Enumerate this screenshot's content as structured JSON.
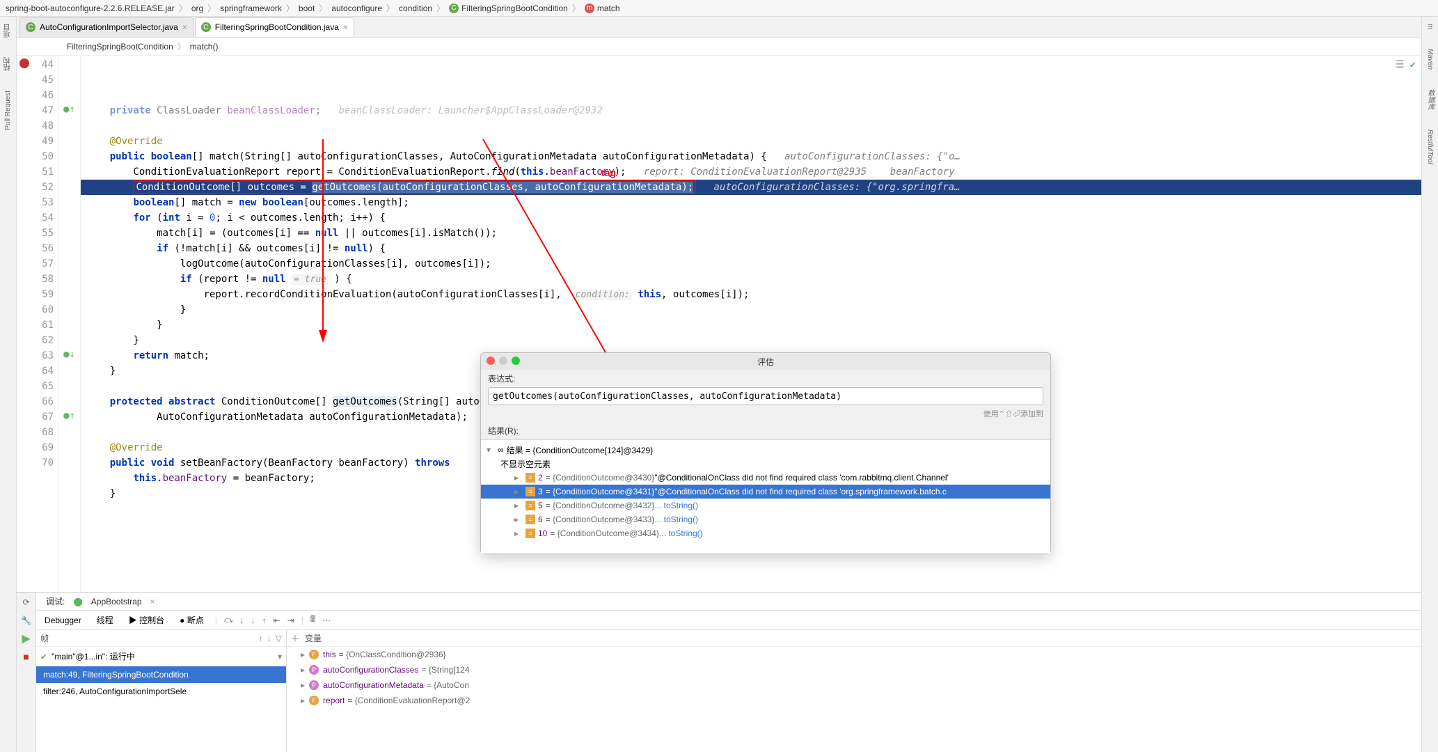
{
  "breadcrumb": {
    "items": [
      "spring-boot-autoconfigure-2.2.6.RELEASE.jar",
      "org",
      "springframework",
      "boot",
      "autoconfigure",
      "condition",
      "FilteringSpringBootCondition",
      "match"
    ],
    "class_icon": "C",
    "method_icon": "m"
  },
  "tabs": [
    {
      "icon": "C",
      "label": "AutoConfigurationImportSelector.java",
      "close": "×"
    },
    {
      "icon": "C",
      "label": "FilteringSpringBootCondition.java",
      "close": "×",
      "active": true
    }
  ],
  "inner_breadcrumb": {
    "class": "FilteringSpringBootCondition",
    "sep": "〉",
    "method": "match()"
  },
  "side_left": {
    "project": "项目",
    "structure": "结构",
    "pull": "Pull Request"
  },
  "side_right": {
    "maven": "Maven",
    "db": "数据库",
    "rest": "RestfulTool",
    "m": "m"
  },
  "editor_icons": {
    "reader": "☰",
    "check": "✔"
  },
  "annotation_tag": "tag",
  "code": {
    "lines": [
      {
        "n": 44,
        "html": "    <span class='kw'>private</span> ClassLoader <span class='field'>beanClassLoader</span>;   <span class='comment'>beanClassLoader: Launcher$AppClassLoader@2932</span>",
        "dim": true
      },
      {
        "n": 45,
        "html": ""
      },
      {
        "n": 46,
        "html": "    <span class='anno'>@Override</span>"
      },
      {
        "n": 47,
        "mark": "green-up",
        "html": "    <span class='kw'>public</span> <span class='kw'>boolean</span>[] match(String[] autoConfigurationClasses, AutoConfigurationMetadata autoConfigurationMetadata) {   <span class='comment'>autoConfigurationClasses: {\"o…</span>"
      },
      {
        "n": 48,
        "html": "        ConditionEvaluationReport report = ConditionEvaluationReport.<span style='font-style:italic'>find</span>(<span class='kw'>this</span>.<span class='field'>beanFactory</span>);   <span class='comment'>report: ConditionEvaluationReport@2935    beanFactory</span>"
      },
      {
        "n": 49,
        "mark": "red",
        "hl": true,
        "html": "        <span class='red-box'>ConditionOutcome[] outcomes = <span class='selbg'>getOutcomes(autoConfigurationClasses, autoConfigurationMetadata);</span></span>   <span class='comment' style='color:#cfd8e6'>autoConfigurationClasses: {\"org.springfra…</span>"
      },
      {
        "n": 50,
        "html": "        <span class='kw'>boolean</span>[] match = <span class='kw'>new</span> <span class='kw'>boolean</span>[outcomes.length];"
      },
      {
        "n": 51,
        "html": "        <span class='kw'>for</span> (<span class='kw'>int</span> i = <span class='num'>0</span>; i &lt; outcomes.length; i++) {"
      },
      {
        "n": 52,
        "html": "            match[i] = (outcomes[i] == <span class='kw'>null</span> || outcomes[i].isMatch());"
      },
      {
        "n": 53,
        "html": "            <span class='kw'>if</span> (!match[i] &amp;&amp; outcomes[i] != <span class='kw'>null</span>) {"
      },
      {
        "n": 54,
        "html": "                logOutcome(autoConfigurationClasses[i], outcomes[i]);"
      },
      {
        "n": 55,
        "html": "                <span class='kw'>if</span> (report != <span class='kw'>null</span> <span class='inlay'>= true</span> ) {"
      },
      {
        "n": 56,
        "html": "                    report.recordConditionEvaluation(autoConfigurationClasses[i],  <span class='inlay'>condition:</span> <span class='kw'>this</span>, outcomes[i]);"
      },
      {
        "n": 57,
        "html": "                }"
      },
      {
        "n": 58,
        "html": "            }"
      },
      {
        "n": 59,
        "html": "        }"
      },
      {
        "n": 60,
        "html": "        <span class='kw'>return</span> match;"
      },
      {
        "n": 61,
        "html": "    }"
      },
      {
        "n": 62,
        "html": ""
      },
      {
        "n": 63,
        "mark": "arrow-down",
        "html": "    <span class='kw'>protected</span> <span class='kw'>abstract</span> ConditionOutcome[] <span style='background:#e8eef7'>getOutcomes</span>(String[] autoConfigurationClasses,"
      },
      {
        "n": 64,
        "html": "            AutoConfigurationMetadata autoConfigurationMetadata);"
      },
      {
        "n": 65,
        "html": ""
      },
      {
        "n": 66,
        "html": "    <span class='anno'>@Override</span>"
      },
      {
        "n": 67,
        "mark": "green-up",
        "html": "    <span class='kw'>public</span> <span class='kw'>void</span> setBeanFactory(BeanFactory beanFactory) <span class='kw'>throws</span>"
      },
      {
        "n": 68,
        "html": "        <span class='kw'>this</span>.<span class='field'>beanFactory</span> = beanFactory;"
      },
      {
        "n": 69,
        "html": "    }"
      },
      {
        "n": 70,
        "html": "",
        "dim": true
      }
    ]
  },
  "debug": {
    "title_tab": "调试:",
    "run_config": "AppBootstrap",
    "tabs": {
      "debugger": "Debugger",
      "threads": "线程",
      "console": "控制台",
      "breakpoints": "断点"
    },
    "toolbar_icons": [
      "↶",
      "↷",
      "↓",
      "↑",
      "⤓",
      "⤒",
      "⟲",
      "≡",
      "🖩",
      "⋯"
    ],
    "frames": {
      "header": "帧",
      "thread": "\"main\"@1...in\": 运行中",
      "items": [
        {
          "text": "match:49, FilteringSpringBootCondition",
          "sel": true
        },
        {
          "text": "filter:246, AutoConfigurationImportSele"
        }
      ]
    },
    "vars": {
      "header": "变量",
      "items": [
        {
          "icon": "f",
          "name": "this",
          "val": "= {OnClassCondition@2936}"
        },
        {
          "icon": "p",
          "name": "autoConfigurationClasses",
          "val": "= {String[124"
        },
        {
          "icon": "p",
          "name": "autoConfigurationMetadata",
          "val": "= {AutoCon"
        },
        {
          "icon": "f",
          "name": "report",
          "val": "= {ConditionEvaluationReport@2"
        }
      ]
    }
  },
  "eval": {
    "title": "评估",
    "expr_label": "表达式:",
    "expr_value": "getOutcomes(autoConfigurationClasses, autoConfigurationMetadata)",
    "hint": "使用⌃⇧⏎添加到",
    "result_label": "结果(R):",
    "root": "结果 = {ConditionOutcome[124]@3429}",
    "hide_empty": "不显示空元素",
    "rows": [
      {
        "idx": "2",
        "obj": "= {ConditionOutcome@3430}",
        "msg": "\"@ConditionalOnClass did not find required class 'com.rabbitmq.client.Channel'"
      },
      {
        "idx": "3",
        "obj": "= {ConditionOutcome@3431}",
        "msg": "\"@ConditionalOnClass did not find required class 'org.springframework.batch.c",
        "sel": true
      },
      {
        "idx": "5",
        "obj": "= {ConditionOutcome@3432}",
        "link": "... toString()"
      },
      {
        "idx": "6",
        "obj": "= {ConditionOutcome@3433}",
        "link": "... toString()"
      },
      {
        "idx": "10",
        "obj": "= {ConditionOutcome@3434}",
        "link": "... toString()"
      }
    ]
  }
}
